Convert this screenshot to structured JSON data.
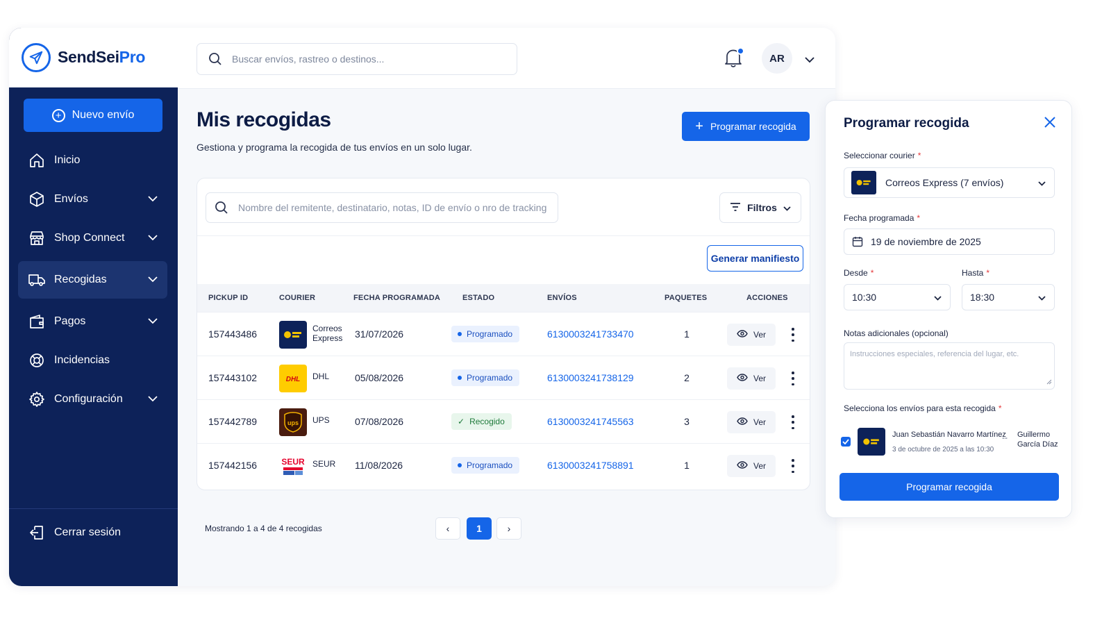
{
  "brand": {
    "name_main": "SendSei",
    "name_accent": "Pro",
    "accent": "#1565e8",
    "sidebar_bg": "#0d2259"
  },
  "sidebar": {
    "new_button": "Nuevo envío",
    "items": [
      {
        "label": "Inicio",
        "icon": "home-icon",
        "has_submenu": false
      },
      {
        "label": "Envíos",
        "icon": "box-icon",
        "has_submenu": true
      },
      {
        "label": "Shop Connect",
        "icon": "store-icon",
        "has_submenu": true
      },
      {
        "label": "Recogidas",
        "icon": "truck-icon",
        "has_submenu": true,
        "active": true
      },
      {
        "label": "Pagos",
        "icon": "wallet-icon",
        "has_submenu": true
      },
      {
        "label": "Incidencias",
        "icon": "lifebuoy-icon",
        "has_submenu": false
      },
      {
        "label": "Configuración",
        "icon": "gear-icon",
        "has_submenu": true
      }
    ],
    "logout": "Cerrar sesión"
  },
  "topbar": {
    "search_placeholder": "Buscar envíos, rastreo o destinos...",
    "avatar_initials": "AR"
  },
  "main": {
    "title": "Mis recogidas",
    "subtitle": "Gestiona y programa la recogida de tus envíos en un solo lugar.",
    "schedule_button": "Programar recogida",
    "search_placeholder": "Nombre del remitente, destinatario, notas, ID de envío o nro de tracking",
    "filters_label": "Filtros",
    "manifest_button": "Generar manifiesto",
    "columns": [
      "PICKUP ID",
      "COURIER",
      "FECHA PROGRAMADA",
      "ESTADO",
      "ENVÍOS",
      "PAQUETES",
      "ACCIONES"
    ],
    "rows": [
      {
        "pickup_id": "157443486",
        "courier_line1": "Correos",
        "courier_line2": "Express",
        "logo": "correos",
        "date": "31/07/2026",
        "status": "Programado",
        "status_type": "scheduled",
        "shipment": "6130003241733470",
        "packages": "1",
        "action": "Ver"
      },
      {
        "pickup_id": "157443102",
        "courier_line1": "DHL",
        "courier_line2": "",
        "logo": "dhl",
        "date": "05/08/2026",
        "status": "Programado",
        "status_type": "scheduled",
        "shipment": "6130003241738129",
        "packages": "2",
        "action": "Ver"
      },
      {
        "pickup_id": "157442789",
        "courier_line1": "UPS",
        "courier_line2": "",
        "logo": "ups",
        "date": "07/08/2026",
        "status": "Recogido",
        "status_type": "collected",
        "shipment": "6130003241745563",
        "packages": "3",
        "action": "Ver"
      },
      {
        "pickup_id": "157442156",
        "courier_line1": "SEUR",
        "courier_line2": "",
        "logo": "seur",
        "date": "11/08/2026",
        "status": "Programado",
        "status_type": "scheduled",
        "shipment": "6130003241758891",
        "packages": "1",
        "action": "Ver"
      }
    ],
    "pagination": {
      "summary": "Mostrando 1 a 4 de 4 recogidas",
      "current_page": "1",
      "prev": "‹",
      "next": "›"
    }
  },
  "panel": {
    "title": "Programar recogida",
    "courier_label": "Seleccionar courier",
    "courier_value": "Correos Express (7 envíos)",
    "date_label": "Fecha programada",
    "date_value": "19 de noviembre de 2025",
    "from_label": "Desde",
    "from_value": "10:30",
    "to_label": "Hasta",
    "to_value": "18:30",
    "notes_label": "Notas adicionales (opcional)",
    "notes_placeholder": "Instrucciones especiales, referencia del lugar, etc.",
    "shipments_label": "Selecciona los envíos para esta recogida",
    "required_mark": "*",
    "shipment": {
      "checked": true,
      "sender": "Juan Sebastián Navarro Martínez",
      "date": "3 de octubre de 2025 a las 10:30",
      "separator": "--",
      "recipient_line1": "Guillermo",
      "recipient_line2": "García Díaz"
    },
    "submit": "Programar recogida"
  }
}
